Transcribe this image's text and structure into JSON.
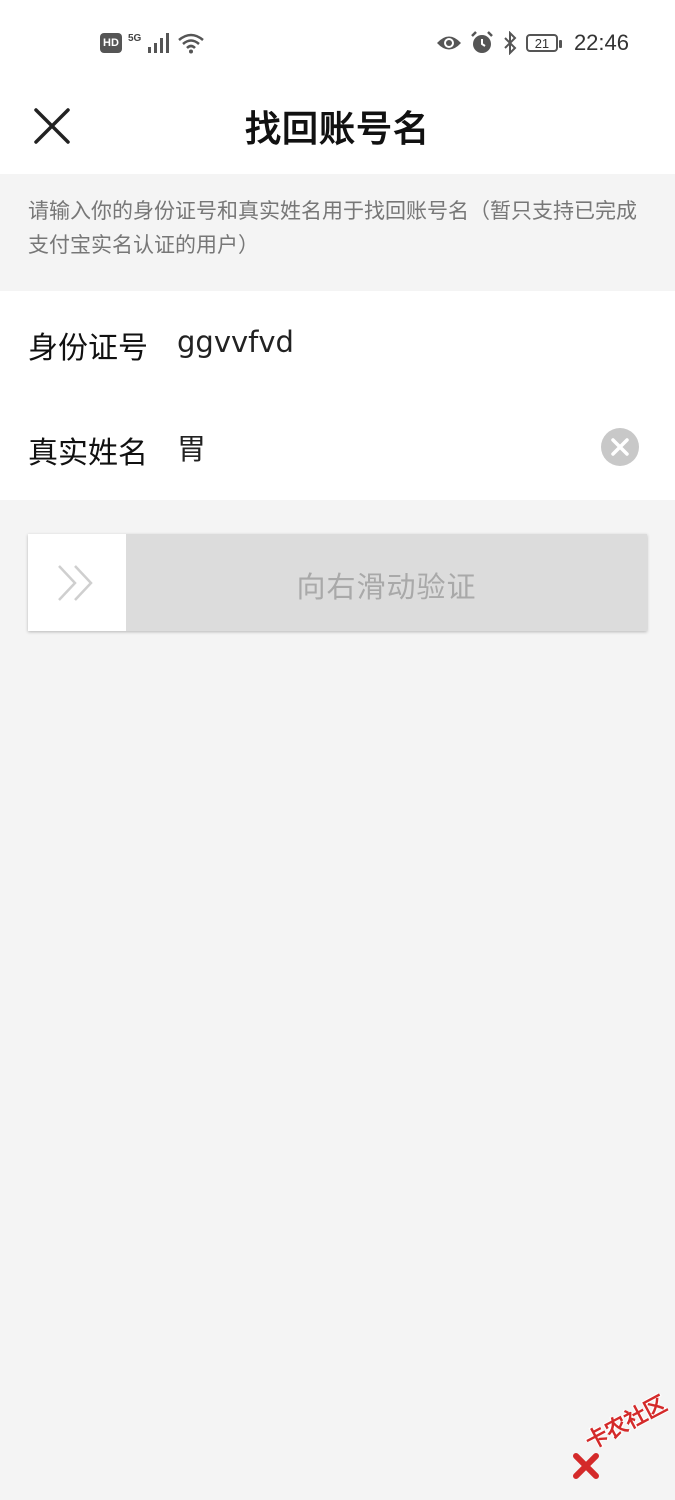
{
  "status_bar": {
    "hd_label": "HD",
    "network_label": "5G",
    "time": "22:46",
    "battery_level": "21"
  },
  "nav": {
    "title": "找回账号名"
  },
  "notice": {
    "text": "请输入你的身份证号和真实姓名用于找回账号名（暂只支持已完成支付宝实名认证的用户）"
  },
  "form": {
    "id_label": "身份证号",
    "id_value": "ggvvfvd",
    "name_label": "真实姓名",
    "name_value": "胃"
  },
  "slider": {
    "label": "向右滑动验证"
  },
  "watermark": {
    "text": "卡农社区"
  },
  "colors": {
    "page_bg": "#f4f4f4",
    "card_bg": "#ffffff",
    "slider_track": "#dcdcdc",
    "muted_text": "#777777",
    "watermark_red": "#d42a2a"
  }
}
